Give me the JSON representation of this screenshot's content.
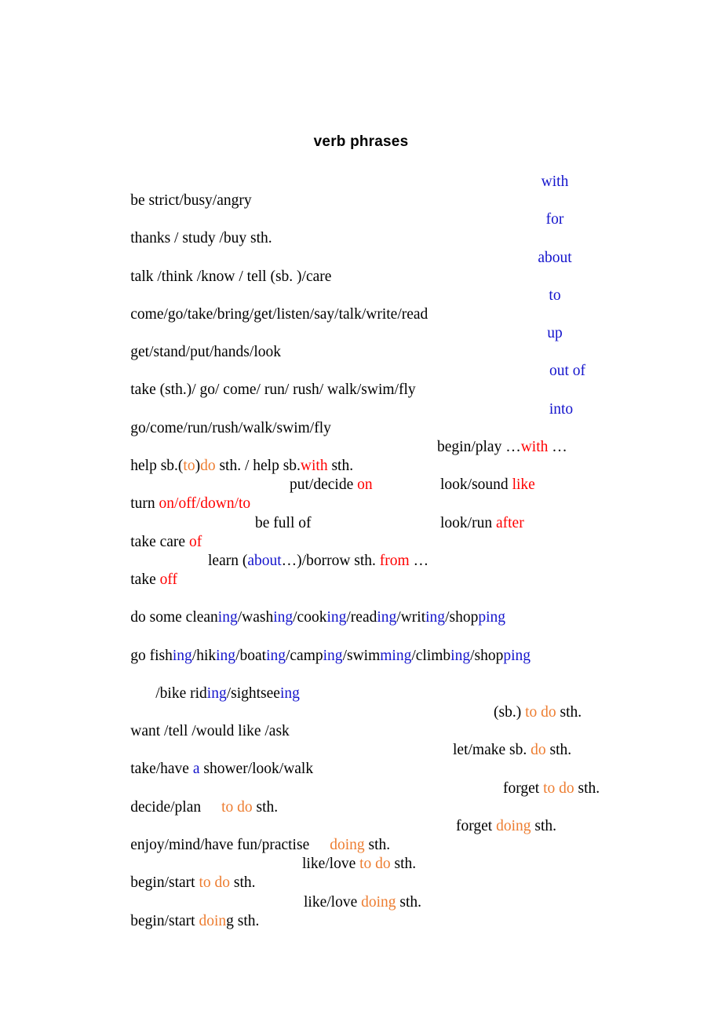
{
  "document": {
    "title": "verb phrases",
    "colors": {
      "text": "#000000",
      "blue": "#1414CC",
      "red": "#FF0000",
      "orange": "#ED7D31",
      "background": "#FFFFFF"
    }
  },
  "prep_rows": [
    {
      "verbs": "be strict/busy/angry",
      "prep": "with"
    },
    {
      "verbs": "thanks / study /buy sth.",
      "prep": "for"
    },
    {
      "verbs": "talk /think /know / tell (sb. )/care",
      "prep": "about"
    },
    {
      "verbs": "come/go/take/bring/get/listen/say/talk/write/read",
      "prep": "to"
    },
    {
      "verbs": "get/stand/put/hands/look",
      "prep": "up"
    },
    {
      "verbs": "take (sth.)/ go/ come/ run/ rush/ walk/swim/fly",
      "prep": "out of"
    },
    {
      "verbs": "go/come/run/rush/walk/swim/fly",
      "prep": "into"
    }
  ],
  "mixed_rows": {
    "help_row": {
      "a1": "help sb.(",
      "a2": "to",
      "a3": ")",
      "a4": "do",
      "a5": " sth. / help sb.",
      "a6": "with",
      "a7": " sth.",
      "b1": "begin/play …",
      "b2": "with",
      "b3": " …"
    },
    "turn_row": {
      "a1": "turn ",
      "a2": "on/off/down/to",
      "b1": "put/decide ",
      "b2": "on",
      "c1": "look/sound ",
      "c2": "like"
    },
    "care_row": {
      "a1": "take care ",
      "a2": "of",
      "b1": "be full of",
      "c1": "look/run ",
      "c2": "after"
    },
    "takeoff_row": {
      "a1": "take ",
      "a2": "off",
      "b1": "learn (",
      "b2": "about",
      "b3": "…)/borrow sth. ",
      "b4": "from",
      "b5": " …"
    }
  },
  "ing_rows": [
    {
      "parts": [
        {
          "t": "do some clean",
          "c": "black"
        },
        {
          "t": "ing",
          "c": "blue"
        },
        {
          "t": "/wash",
          "c": "black"
        },
        {
          "t": "ing",
          "c": "blue"
        },
        {
          "t": "/cook",
          "c": "black"
        },
        {
          "t": "ing",
          "c": "blue"
        },
        {
          "t": "/read",
          "c": "black"
        },
        {
          "t": "ing",
          "c": "blue"
        },
        {
          "t": "/writ",
          "c": "black"
        },
        {
          "t": "ing",
          "c": "blue"
        },
        {
          "t": "/shop",
          "c": "black"
        },
        {
          "t": "ping",
          "c": "blue"
        }
      ]
    },
    {
      "parts": [
        {
          "t": "go fish",
          "c": "black"
        },
        {
          "t": "ing",
          "c": "blue"
        },
        {
          "t": "/hik",
          "c": "black"
        },
        {
          "t": "ing",
          "c": "blue"
        },
        {
          "t": "/boat",
          "c": "black"
        },
        {
          "t": "ing",
          "c": "blue"
        },
        {
          "t": "/camp",
          "c": "black"
        },
        {
          "t": "ing",
          "c": "blue"
        },
        {
          "t": "/swim",
          "c": "black"
        },
        {
          "t": "ming",
          "c": "blue"
        },
        {
          "t": "/climb",
          "c": "black"
        },
        {
          "t": "ing",
          "c": "blue"
        },
        {
          "t": "/shop",
          "c": "black"
        },
        {
          "t": "ping",
          "c": "blue"
        }
      ]
    },
    {
      "indent": true,
      "parts": [
        {
          "t": "/bike rid",
          "c": "black"
        },
        {
          "t": "ing",
          "c": "blue"
        },
        {
          "t": "/sightsee",
          "c": "black"
        },
        {
          "t": "ing",
          "c": "blue"
        }
      ]
    }
  ],
  "infinitive_rows": {
    "want_row": {
      "a1": "want /tell /would like /ask",
      "b1": "(sb.) ",
      "b2": "to do",
      "b3": " sth."
    },
    "shower_row": {
      "a1": "take/have ",
      "a2": "a",
      "a3": " shower/look/walk",
      "b1": "let/make sb. ",
      "b2": "do",
      "b3": " sth."
    },
    "decide_row": {
      "a1": "decide/plan",
      "a2": "to do",
      "a3": " sth.",
      "b1": "forget ",
      "b2": "to do",
      "b3": " sth."
    },
    "enjoy_row": {
      "a1": "enjoy/mind/have fun/practise",
      "a2": "doing",
      "a3": " sth.",
      "b1": "forget ",
      "b2": "doing",
      "b3": " sth."
    },
    "begin_todo_row": {
      "a1": "begin/start ",
      "a2": "to do",
      "a3": " sth.",
      "b1": "like/love ",
      "b2": "to do",
      "b3": " sth."
    },
    "begin_doing_row": {
      "a1": "begin/start ",
      "a2": "doin",
      "a3": "g sth.",
      "b1": "like/love ",
      "b2": "doing",
      "b3": " sth."
    }
  }
}
